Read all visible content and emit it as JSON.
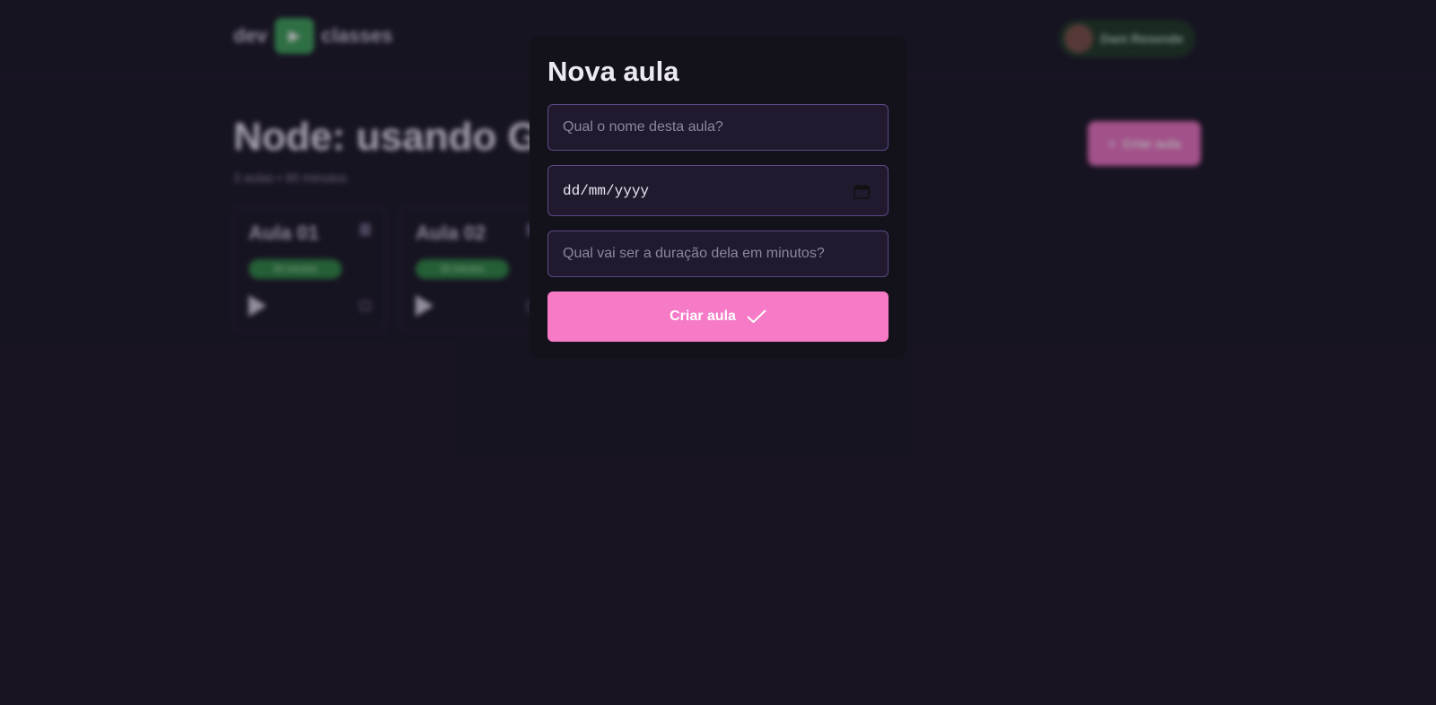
{
  "header": {
    "logo_left": "dev",
    "logo_right": "classes",
    "user_name": "Dani Resende"
  },
  "course": {
    "title": "Node: usando GraphQL",
    "meta": "3 aulas • 90 minutos",
    "create_button_label": "Criar aula"
  },
  "lessons": [
    {
      "title": "Aula 01",
      "badge": "30 minutos"
    },
    {
      "title": "Aula 02",
      "badge": "30 minutos"
    }
  ],
  "modal": {
    "title": "Nova aula",
    "name_placeholder": "Qual o nome desta aula?",
    "date_placeholder": "dd/mm/yyyy",
    "duration_placeholder": "Qual vai ser a duração dela em minutos?",
    "submit_label": "Criar aula"
  },
  "colors": {
    "background": "#1b1726",
    "modal_bg": "#13111a",
    "accent_pink": "#f77ac7",
    "accent_green": "#3fa45b",
    "field_border": "#5b4a86"
  },
  "icons": {
    "date_picker": "calendar-icon",
    "submit": "check-icon",
    "lesson_play": "play-icon"
  }
}
